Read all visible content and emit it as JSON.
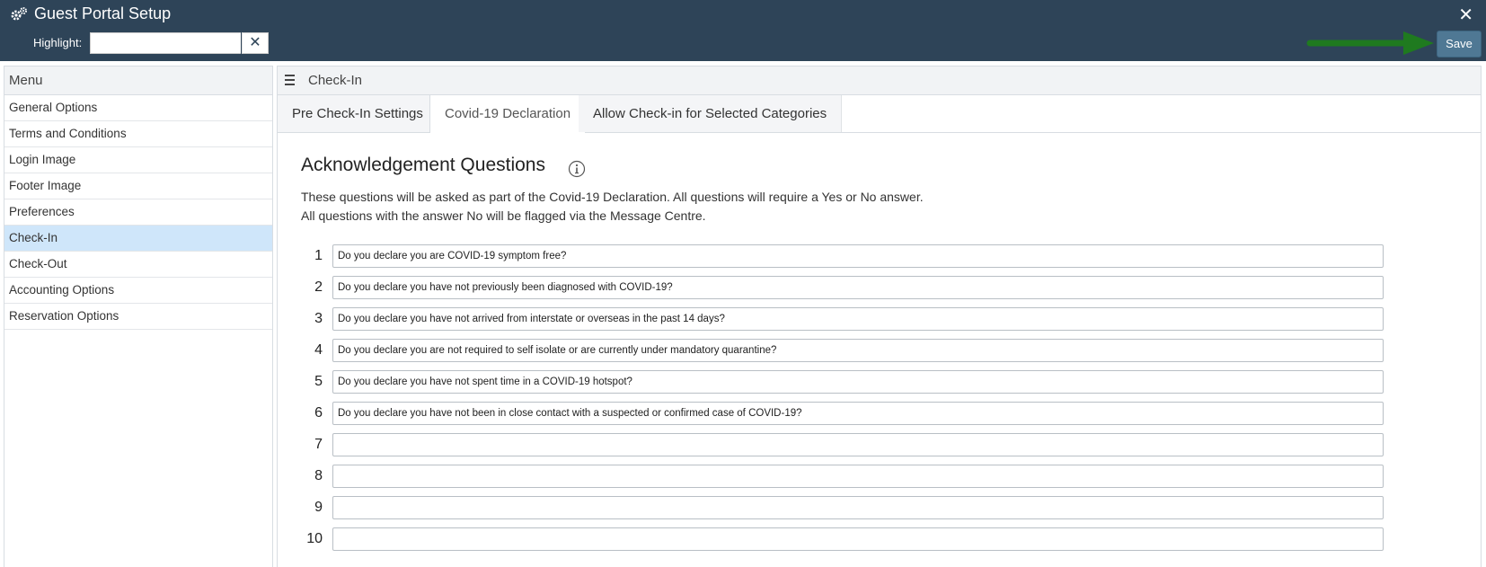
{
  "window": {
    "title": "Guest Portal Setup"
  },
  "header": {
    "highlight_label": "Highlight:",
    "highlight_value": "",
    "clear_symbol": "✕",
    "close_symbol": "✕",
    "save_label": "Save",
    "arrow_color": "#1f7a1f"
  },
  "sidebar": {
    "heading": "Menu",
    "items": [
      {
        "label": "General Options",
        "active": false
      },
      {
        "label": "Terms and Conditions",
        "active": false
      },
      {
        "label": "Login Image",
        "active": false
      },
      {
        "label": "Footer Image",
        "active": false
      },
      {
        "label": "Preferences",
        "active": false
      },
      {
        "label": "Check-In",
        "active": true
      },
      {
        "label": "Check-Out",
        "active": false
      },
      {
        "label": "Accounting Options",
        "active": false
      },
      {
        "label": "Reservation Options",
        "active": false
      }
    ]
  },
  "panel": {
    "title": "Check-In",
    "tabs": [
      {
        "label": "Pre Check-In Settings",
        "active": false
      },
      {
        "label": "Covid-19 Declaration",
        "active": true
      },
      {
        "label": "Allow Check-in for Selected Categories",
        "active": false
      }
    ],
    "section_title": "Acknowledgement Questions",
    "description_line1": "These questions will be asked as part of the Covid-19 Declaration. All questions will require a Yes or No answer.",
    "description_line2": "All questions with the answer No will be flagged via the Message Centre.",
    "questions": [
      {
        "number": "1",
        "value": "Do you declare you are COVID-19 symptom free?"
      },
      {
        "number": "2",
        "value": "Do you declare you have not previously been diagnosed with COVID-19?"
      },
      {
        "number": "3",
        "value": "Do you declare you have not arrived from interstate or overseas in the past 14 days?"
      },
      {
        "number": "4",
        "value": "Do you declare you are not required to self isolate or are currently under mandatory quarantine?"
      },
      {
        "number": "5",
        "value": "Do you declare you have not spent time in a COVID-19 hotspot?"
      },
      {
        "number": "6",
        "value": "Do you declare you have not been in close contact with a suspected or confirmed case of COVID-19?"
      },
      {
        "number": "7",
        "value": ""
      },
      {
        "number": "8",
        "value": ""
      },
      {
        "number": "9",
        "value": ""
      },
      {
        "number": "10",
        "value": ""
      }
    ]
  },
  "colors": {
    "header_bg": "#2e4458",
    "active_menu_bg": "#cfe6fa",
    "save_bg": "#4f7894"
  }
}
